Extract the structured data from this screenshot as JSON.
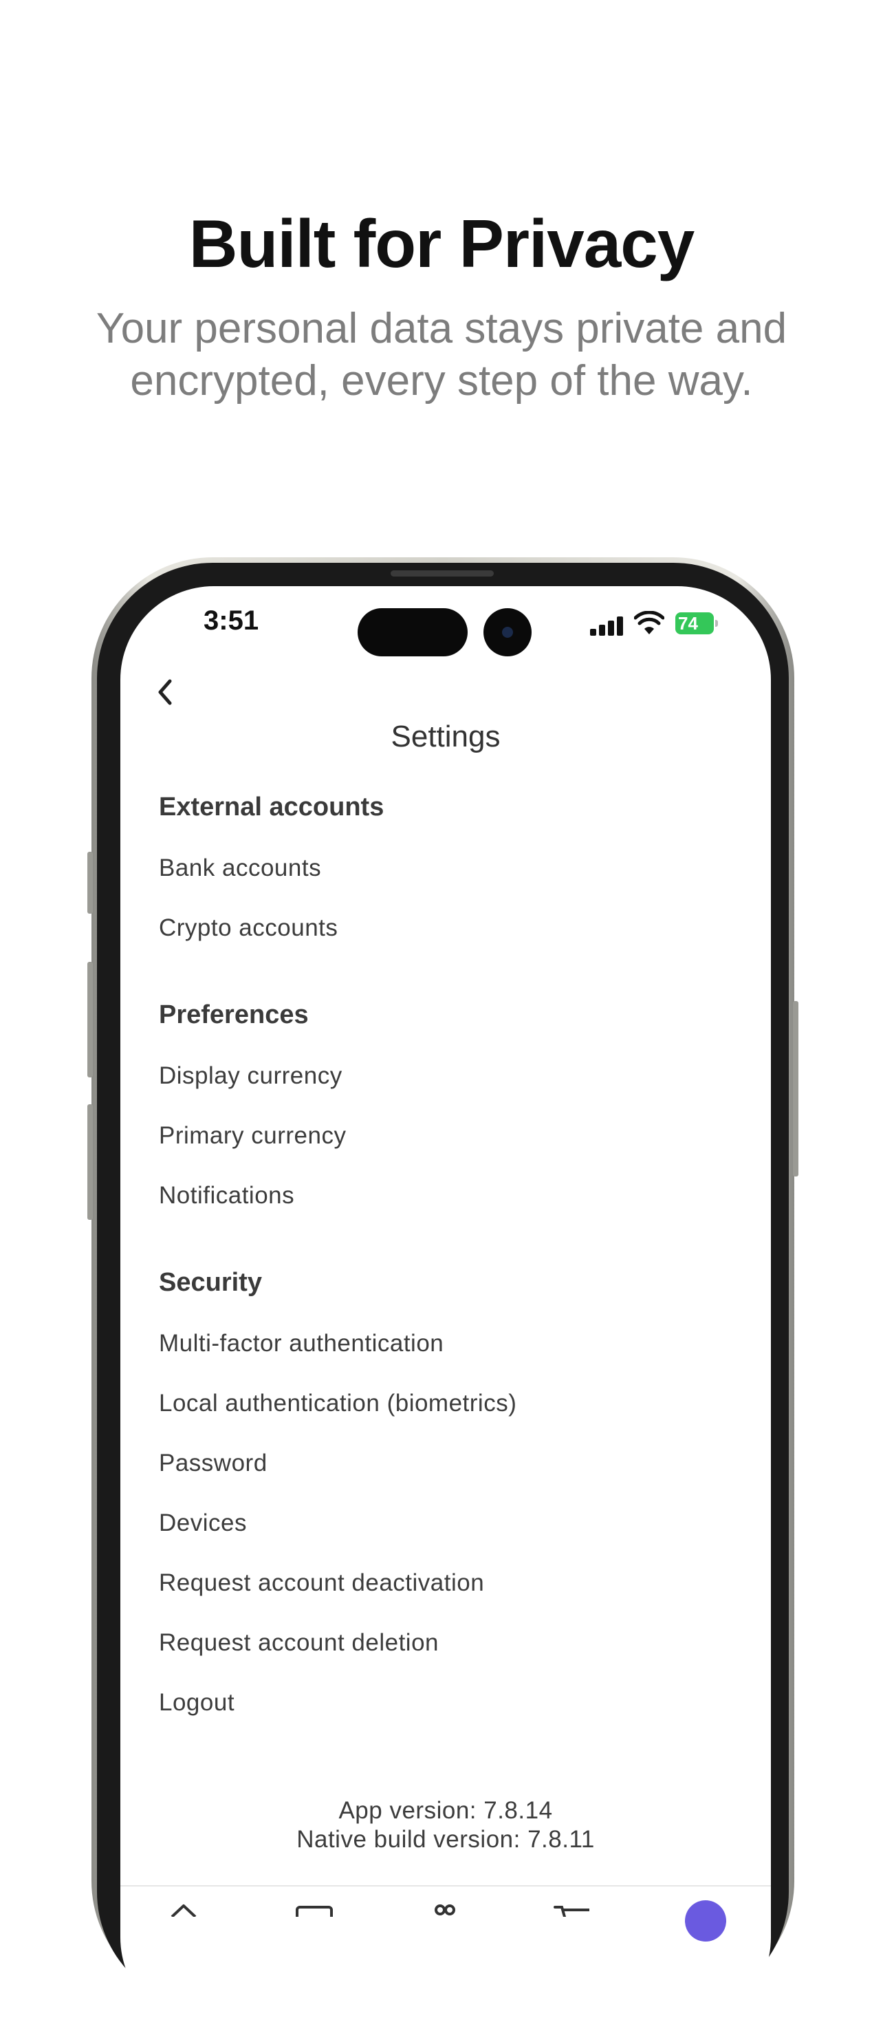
{
  "hero": {
    "title": "Built for Privacy",
    "subtitle_line1": "Your personal data stays private and",
    "subtitle_line2": "encrypted, every step of the way."
  },
  "status_bar": {
    "time": "3:51",
    "battery": "74"
  },
  "header": {
    "back_icon": "chevron-left-icon",
    "title": "Settings"
  },
  "sections": {
    "external": {
      "title": "External accounts",
      "items": [
        "Bank accounts",
        "Crypto accounts"
      ]
    },
    "preferences": {
      "title": "Preferences",
      "items": [
        "Display currency",
        "Primary currency",
        "Notifications"
      ]
    },
    "security": {
      "title": "Security",
      "items": [
        "Multi-factor authentication",
        "Local authentication (biometrics)",
        "Password",
        "Devices",
        "Request account deactivation",
        "Request account deletion",
        "Logout"
      ]
    }
  },
  "footer": {
    "app_version": "App version: 7.8.14",
    "native_build_version": "Native build version: 7.8.11"
  },
  "tab_bar": {
    "icons": [
      "home-icon",
      "card-icon",
      "gift-icon",
      "cart-icon",
      "profile-avatar-icon"
    ]
  },
  "colors": {
    "accent": "#6a5ae0",
    "battery": "#34c759"
  }
}
